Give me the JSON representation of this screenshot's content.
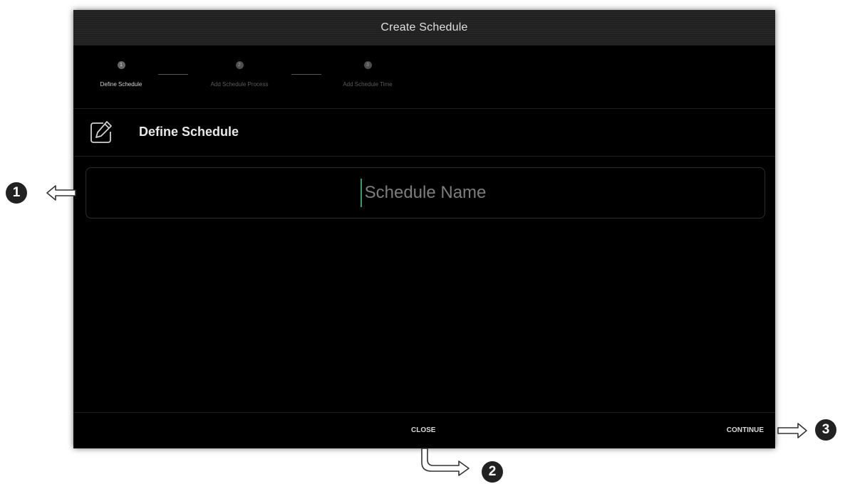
{
  "dialog": {
    "title": "Create Schedule"
  },
  "stepper": {
    "steps": [
      {
        "number": "1",
        "label": "Define Schedule",
        "active": true
      },
      {
        "number": "2",
        "label": "Add Schedule Process",
        "active": false
      },
      {
        "number": "3",
        "label": "Add Schedule Time",
        "active": false
      }
    ]
  },
  "section": {
    "title": "Define Schedule",
    "icon": "edit-icon"
  },
  "name_field": {
    "placeholder": "Schedule Name",
    "value": ""
  },
  "footer": {
    "close_label": "CLOSE",
    "continue_label": "CONTINUE"
  },
  "callouts": [
    {
      "number": "1",
      "target": "schedule-name-input"
    },
    {
      "number": "2",
      "target": "close-button"
    },
    {
      "number": "3",
      "target": "continue-button"
    }
  ]
}
